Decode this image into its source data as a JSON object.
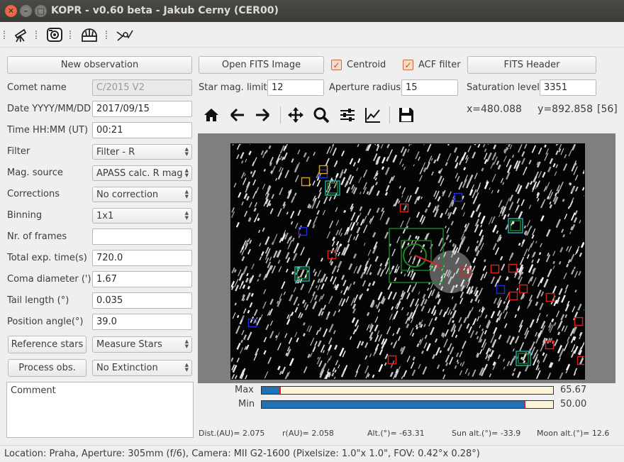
{
  "window": {
    "title": "KOPR - v0.60 beta - Jakub Cerny (CER00)"
  },
  "toolbar": {
    "icons": [
      "telescope-icon",
      "camera-icon",
      "observatory-icon",
      "comet-icon"
    ]
  },
  "left_panel": {
    "new_observation": "New observation",
    "fields": [
      {
        "label": "Comet name",
        "value": "C/2015 V2"
      },
      {
        "label": "Date YYYY/MM/DD",
        "value": "2017/09/15"
      },
      {
        "label": "Time HH:MM (UT)",
        "value": "00:21"
      },
      {
        "label": "Filter",
        "value": "Filter - R"
      },
      {
        "label": "Mag. source",
        "value": "APASS calc. R mag"
      },
      {
        "label": "Corrections",
        "value": "No correction"
      },
      {
        "label": "Binning",
        "value": "1x1"
      },
      {
        "label": "Nr. of frames",
        "value": ""
      },
      {
        "label": "Total exp. time(s)",
        "value": "720.0"
      },
      {
        "label": "Coma diameter (')",
        "value": "1.67"
      },
      {
        "label": "Tail length (°)",
        "value": "0.035"
      },
      {
        "label": "Position angle(°)",
        "value": "39.0"
      }
    ],
    "reference_stars": "Reference stars",
    "measure_stars": "Measure Stars",
    "process_obs": "Process obs.",
    "extinction": "No Extinction",
    "comment_placeholder": "Comment"
  },
  "top_controls": {
    "open_fits": "Open FITS Image",
    "centroid_label": "Centroid",
    "centroid_checked": true,
    "acf_label": "ACF filter",
    "acf_checked": true,
    "fits_header": "FITS Header",
    "star_mag_label": "Star mag. limit",
    "star_mag_value": "12",
    "aperture_label": "Aperture radius",
    "aperture_value": "15",
    "saturation_label": "Saturation level",
    "saturation_value": "3351"
  },
  "plot_toolbar": {
    "icons": [
      "home-icon",
      "back-arrow-icon",
      "forward-arrow-icon",
      "pan-icon",
      "zoom-icon",
      "configure-subplots-icon",
      "edit-curve-icon",
      "save-icon"
    ],
    "coords": "x=480.088     y=892.858",
    "pixel_value": "[56]"
  },
  "colorbar": {
    "max_label": "Max",
    "min_label": "Min",
    "max_value": "65.67",
    "min_value": "50.00",
    "max_fraction": 0.06,
    "min_fraction": 0.9
  },
  "ephemeris": {
    "dist": "Dist.(AU)= 2.075",
    "r": "r(AU)= 2.058",
    "alt": "Alt.(°)= -63.31",
    "sun_alt": "Sun alt.(°)= -33.9",
    "moon_alt": "Moon alt.(°)= 12.6"
  },
  "status": "Location: Praha, Aperture: 305mm (f/6), Camera: MII G2-1600 (Pixelsize:  1.0\"x 1.0\", FOV:  0.42°x 0.28°)",
  "colors": {
    "accent": "#e2562b",
    "colorbar_fill": "#1f72b8",
    "marker_red": "#e02020",
    "marker_blue": "#2030e0",
    "marker_green": "#1a8a2a",
    "marker_cyan": "#20b0b0",
    "marker_orange": "#e0a020"
  }
}
